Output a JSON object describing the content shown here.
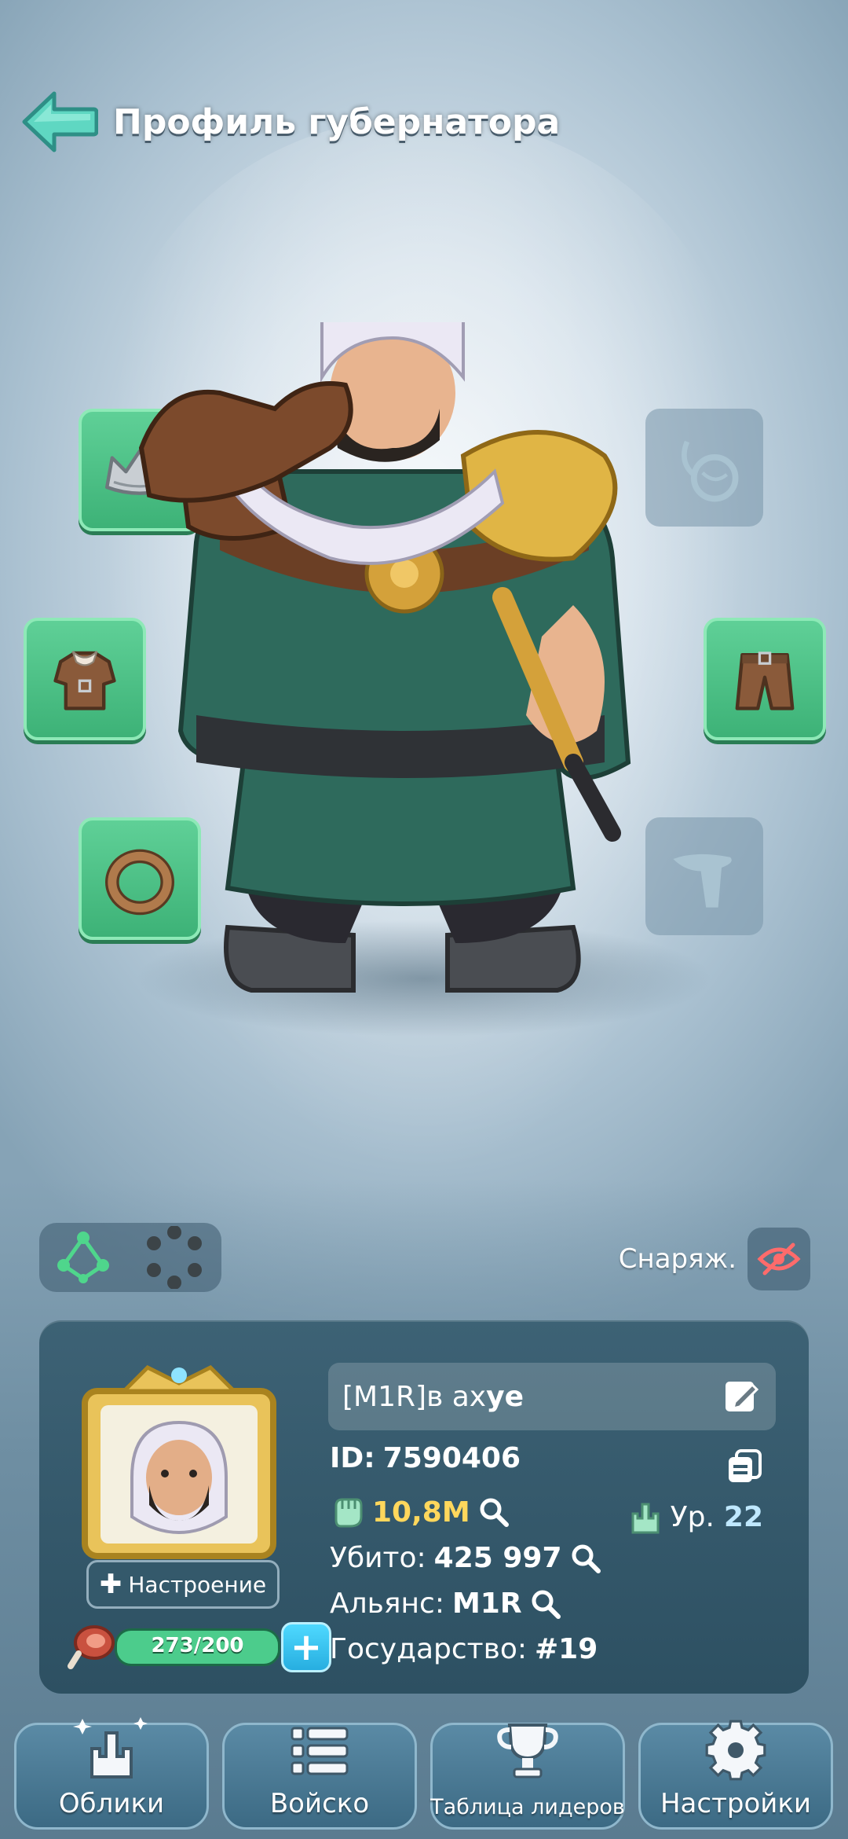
{
  "header": {
    "title": "Профиль губернатора"
  },
  "equipment": {
    "label": "Снаряж."
  },
  "profile": {
    "name_prefix": "[M1R]",
    "name_rest": "в ах",
    "name_bold": "ye",
    "id_label": "ID:",
    "id_value": "7590406",
    "power_value": "10,8M",
    "level_label": "Ур.",
    "level_value": "22",
    "kills_label": "Убито:",
    "kills_value": "425 997",
    "alliance_label": "Альянс:",
    "alliance_value": "M1R",
    "kingdom_label": "Государство:",
    "kingdom_value": "#19",
    "mood_label": "Настроение",
    "stamina_text": "273/200",
    "stamina_fraction": 1.0
  },
  "nav": {
    "skins": "Облики",
    "army": "Войско",
    "leaderboard": "Таблица лидеров",
    "settings": "Настройки"
  },
  "colors": {
    "slot_active": "#4fc487",
    "slot_inactive": "#7d9aae",
    "power": "#ffd75c",
    "card": "#34596b"
  }
}
